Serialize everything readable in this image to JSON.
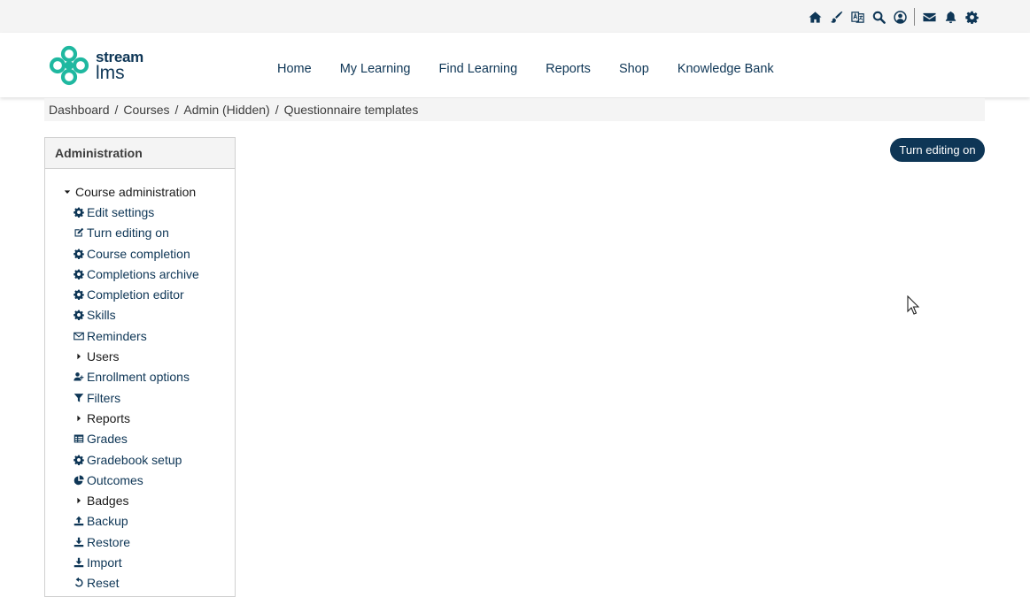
{
  "topbar": {
    "icons": [
      "home-icon",
      "paintbrush-icon",
      "language-icon",
      "search-icon",
      "user-circle-icon",
      "envelope-icon",
      "bell-icon",
      "gear-icon"
    ]
  },
  "logo": {
    "line1": "stream",
    "line2": "lms"
  },
  "nav": {
    "items": [
      {
        "label": "Home"
      },
      {
        "label": "My Learning"
      },
      {
        "label": "Find Learning"
      },
      {
        "label": "Reports"
      },
      {
        "label": "Shop"
      },
      {
        "label": "Knowledge Bank"
      }
    ]
  },
  "breadcrumb": {
    "items": [
      {
        "label": "Dashboard"
      },
      {
        "label": "Courses"
      },
      {
        "label": "Admin (Hidden)"
      },
      {
        "label": "Questionnaire templates"
      }
    ],
    "separator": "/"
  },
  "editing_button": {
    "label": "Turn editing on"
  },
  "admin_block": {
    "title": "Administration",
    "root": {
      "label": "Course administration"
    },
    "items": [
      {
        "label": "Edit settings",
        "icon": "gear-icon"
      },
      {
        "label": "Turn editing on",
        "icon": "edit-icon"
      },
      {
        "label": "Course completion",
        "icon": "gear-icon"
      },
      {
        "label": "Completions archive",
        "icon": "gear-icon"
      },
      {
        "label": "Completion editor",
        "icon": "gear-icon"
      },
      {
        "label": "Skills",
        "icon": "gear-icon"
      },
      {
        "label": "Reminders",
        "icon": "envelope-outline-icon"
      },
      {
        "label": "Users",
        "icon": "caret-right-icon"
      },
      {
        "label": "Enrollment options",
        "icon": "user-plus-icon"
      },
      {
        "label": "Filters",
        "icon": "filter-icon"
      },
      {
        "label": "Reports",
        "icon": "caret-right-icon"
      },
      {
        "label": "Grades",
        "icon": "table-icon"
      },
      {
        "label": "Gradebook setup",
        "icon": "gear-icon"
      },
      {
        "label": "Outcomes",
        "icon": "pie-chart-icon"
      },
      {
        "label": "Badges",
        "icon": "caret-right-icon"
      },
      {
        "label": "Backup",
        "icon": "upload-icon"
      },
      {
        "label": "Restore",
        "icon": "download-icon"
      },
      {
        "label": "Import",
        "icon": "download-icon"
      },
      {
        "label": "Reset",
        "icon": "undo-icon"
      }
    ]
  },
  "colors": {
    "primary": "#0e3656",
    "brand_teal": "#1fb8a0",
    "topbar_bg": "#f4f4f4"
  }
}
